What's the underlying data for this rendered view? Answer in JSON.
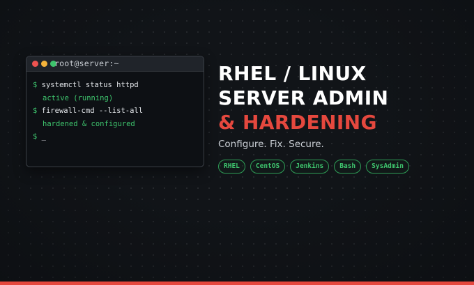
{
  "terminal": {
    "title": "root@server:~",
    "lines": [
      {
        "prompt": "$",
        "text": "systemctl status httpd"
      },
      {
        "output": "active (running)"
      },
      {
        "prompt": "$",
        "text": "firewall-cmd --list-all"
      },
      {
        "output": "hardened & configured"
      },
      {
        "prompt": "$",
        "cursor": "_"
      }
    ]
  },
  "heading": {
    "line1": "RHEL / LINUX",
    "line2": "SERVER ADMIN",
    "line3": "& HARDENING"
  },
  "tagline": "Configure. Fix. Secure.",
  "tags": [
    "RHEL",
    "CentOS",
    "Jenkins",
    "Bash",
    "SysAdmin"
  ],
  "colors": {
    "background": "#111418",
    "accent_red": "#e5483e",
    "accent_green": "#3ec46d",
    "window_close": "#ef5350",
    "window_minimize": "#f5b43b",
    "window_maximize": "#3ec46d"
  }
}
